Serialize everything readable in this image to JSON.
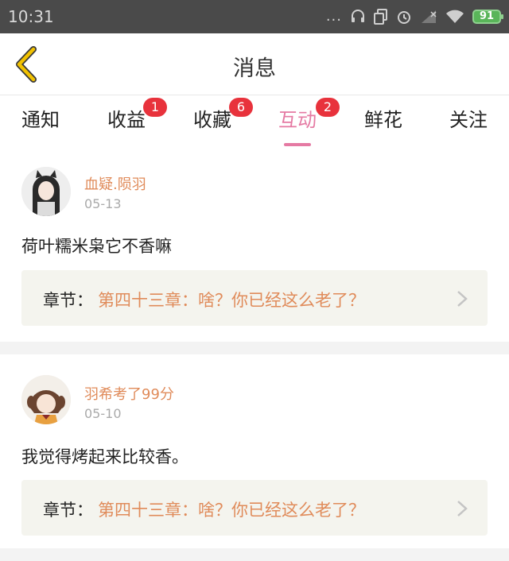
{
  "status_bar": {
    "time": "10:31",
    "dots": "...",
    "battery": "91"
  },
  "header": {
    "title": "消息"
  },
  "tabs": [
    {
      "label": "通知",
      "badge": ""
    },
    {
      "label": "收益",
      "badge": "1"
    },
    {
      "label": "收藏",
      "badge": "6"
    },
    {
      "label": "互动",
      "badge": "2",
      "active": true
    },
    {
      "label": "鲜花",
      "badge": ""
    },
    {
      "label": "关注",
      "badge": ""
    }
  ],
  "messages": [
    {
      "username": "血疑.陨羽",
      "date": "05-13",
      "comment": "荷叶糯米枭它不香嘛",
      "chapter_prefix": "章节：",
      "chapter_name": "第四十三章：啥？你已经这么老了？"
    },
    {
      "username": "羽希考了99分",
      "date": "05-10",
      "comment": "我觉得烤起来比较香。",
      "chapter_prefix": "章节：",
      "chapter_name": "第四十三章：啥？你已经这么老了？"
    }
  ],
  "colors": {
    "accent": "#e57aa3",
    "username": "#e08b5a",
    "badge": "#e8323c",
    "back_arrow": "#f2c200"
  }
}
